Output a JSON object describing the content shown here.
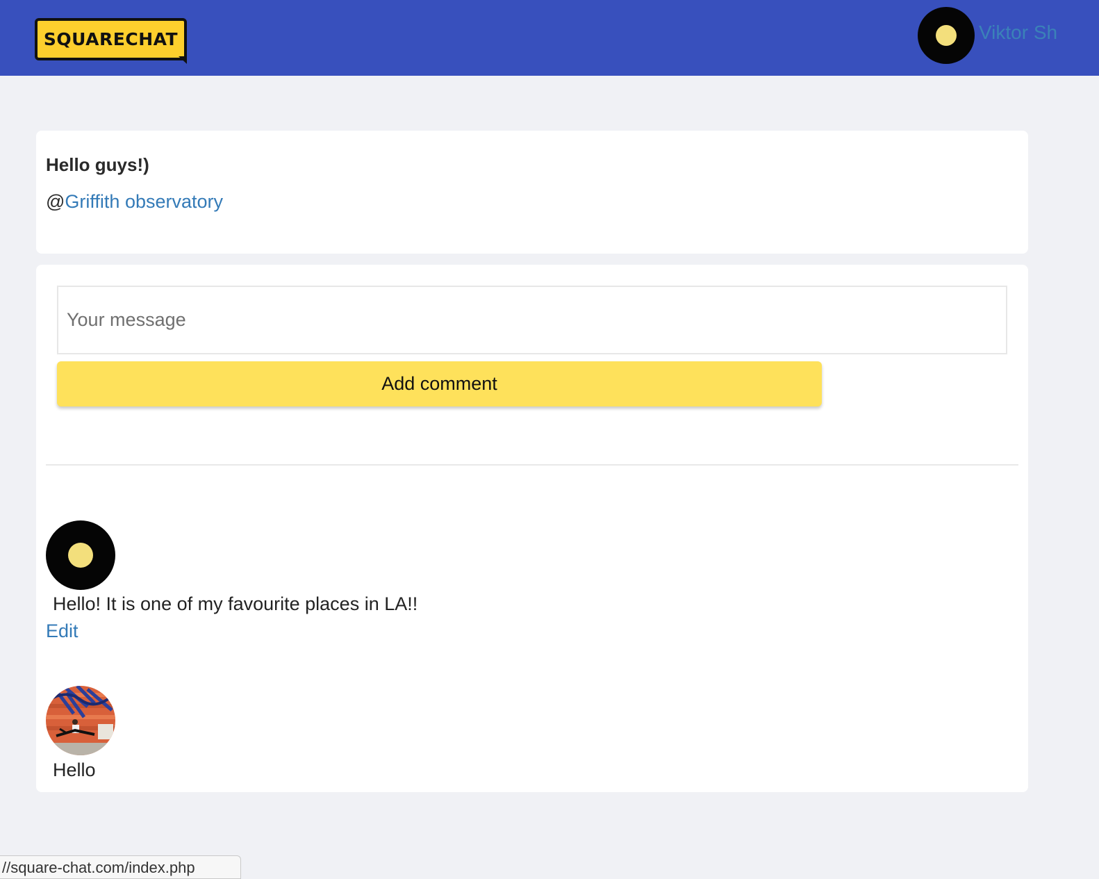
{
  "header": {
    "logo_text": "SQUARECHAT",
    "user_name": "Viktor Sh"
  },
  "post": {
    "title": "Hello guys!)",
    "location_prefix": "@",
    "location_link": "Griffith observatory"
  },
  "comment_form": {
    "placeholder": "Your message",
    "value": "",
    "submit_label": "Add comment"
  },
  "comments": [
    {
      "text": "Hello! It is one of my favourite places in LA!!",
      "edit_label": "Edit"
    },
    {
      "text": "Hello"
    }
  ],
  "status_bar": {
    "url": "//square-chat.com/index.php"
  },
  "colors": {
    "header_bg": "#3850bd",
    "logo_yellow": "#fdcf2d",
    "button_yellow": "#fee15b",
    "link_blue": "#337ab7",
    "page_bg": "#f0f1f5"
  },
  "icons": {
    "user_avatar": "default-avatar-icon",
    "comment_1_avatar": "default-avatar-icon",
    "comment_2_avatar": "user-photo"
  }
}
